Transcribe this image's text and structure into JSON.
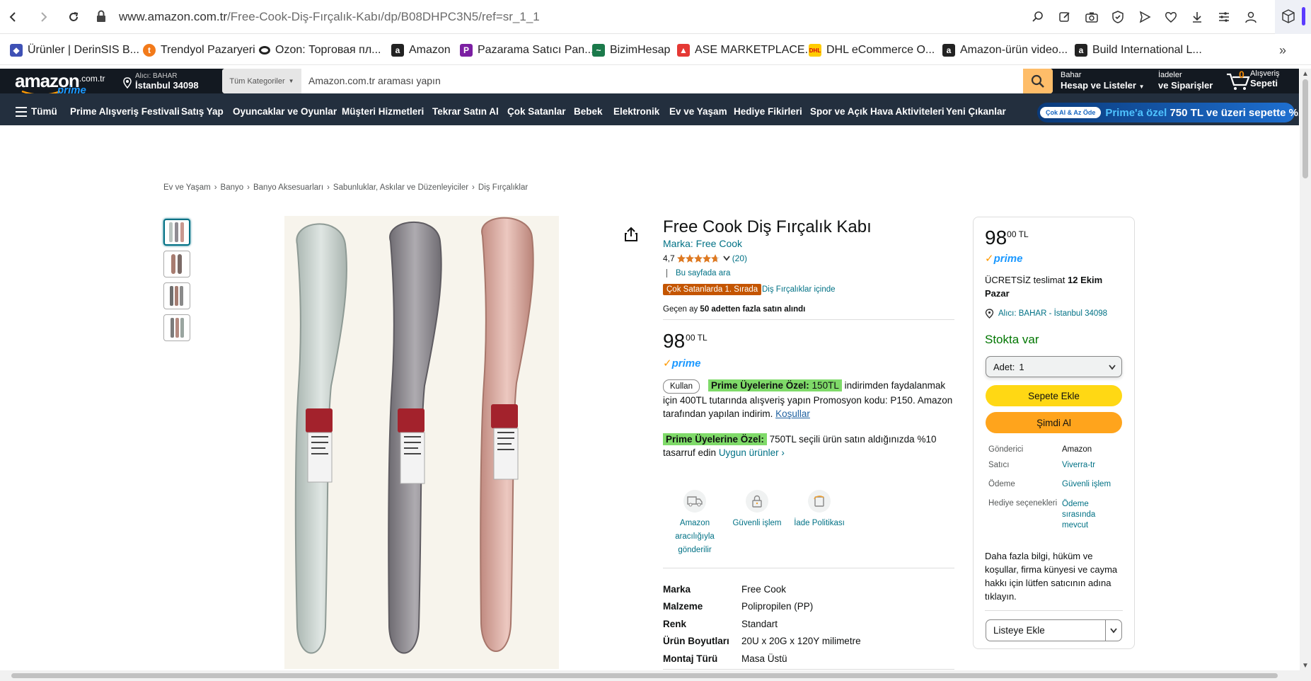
{
  "browser": {
    "url_domain": "www.amazon.com.tr",
    "url_path": "/Free-Cook-Diş-Fırçalık-Kabı/dp/B08DHPC3N5/ref=sr_1_1"
  },
  "bookmarks": [
    {
      "label": "Ürünler | DerinSIS B...",
      "color": "#3f51b5"
    },
    {
      "label": "Trendyol Pazaryeri",
      "color": "#f27a1a"
    },
    {
      "label": "Ozon: Торговая пл...",
      "color": "#222222"
    },
    {
      "label": "Amazon",
      "color": "#222222"
    },
    {
      "label": "Pazarama Satıcı Pan...",
      "color": "#7b1fa2"
    },
    {
      "label": "BizimHesap",
      "color": "#1b7a4b"
    },
    {
      "label": "ASE MARKETPLACE...",
      "color": "#e53935"
    },
    {
      "label": "DHL eCommerce O...",
      "color": "#ffcc00"
    },
    {
      "label": "Amazon-ürün video...",
      "color": "#222222"
    },
    {
      "label": "Build International L...",
      "color": "#222222"
    }
  ],
  "header": {
    "logo_text": "amazon",
    "logo_suffix": ".com.tr",
    "logo_prime": "prime",
    "deliver_line1": "Alıcı: BAHAR",
    "deliver_line2": "İstanbul 34098",
    "search_category": "Tüm Kategoriler",
    "search_placeholder": "Amazon.com.tr araması yapın",
    "account_line1": "Bahar",
    "account_line2": "Hesap ve Listeler",
    "returns_line1": "İadeler",
    "returns_line2": "ve Siparişler",
    "cart_count": "0",
    "cart_line1": "Alışveriş",
    "cart_line2": "Sepeti"
  },
  "nav": {
    "all_label": "Tümü",
    "items": [
      "Prime Alışveriş Festivali",
      "Satış Yap",
      "Oyuncaklar ve Oyunlar",
      "Müşteri Hizmetleri",
      "Tekrar Satın Al",
      "Çok Satanlar",
      "Bebek",
      "Elektronik",
      "Ev ve Yaşam",
      "Hediye Fikirleri",
      "Spor ve Açık Hava Aktiviteleri",
      "Yeni Çıkanlar"
    ],
    "promo_pill": "Çok Al & Az Öde",
    "promo_prefix": "Prime'a özel",
    "promo_text": " 750 TL ve üzeri sepette %10"
  },
  "breadcrumb": [
    "Ev ve Yaşam",
    "Banyo",
    "Banyo Aksesuarları",
    "Sabunluklar, Askılar ve Düzenleyiciler",
    "Diş Fırçalıklar"
  ],
  "product": {
    "title": "Free Cook Diş Fırçalık Kabı",
    "brand_link": "Marka: Free Cook",
    "rating": "4,7",
    "stars": 4.7,
    "rating_count": "(20)",
    "search_page": "Bu sayfada ara",
    "bestseller_badge": "Çok Satanlarda 1. Sırada",
    "bestseller_category": "Diş Fırçalıklar içinde",
    "bought_prefix": "Geçen ay ",
    "bought_bold": "50 adetten fazla satın alındı",
    "price_whole": "98",
    "price_fraction": "00",
    "price_currency": "TL",
    "prime_label": "prime",
    "coupon": {
      "button": "Kullan",
      "badge": "Prime Üyelerine Özel:",
      "amount": "150TL",
      "text": " indirimden faydalanmak için 400TL tutarında alışveriş yapın Promosyon kodu: P150. Amazon tarafından yapılan indirim.",
      "terms": "Koşullar"
    },
    "prime_offer": {
      "badge": "Prime Üyelerine Özel:",
      "text": " 750TL seçili ürün satın aldığınızda %10 tasarruf edin",
      "link": "Uygun ürünler ›"
    },
    "features": [
      {
        "label": "Amazon aracılığıyla gönderilir",
        "icon": "truck-icon"
      },
      {
        "label": "Güvenli işlem",
        "icon": "lock-icon"
      },
      {
        "label": "İade Politikası",
        "icon": "return-icon"
      }
    ],
    "specs": [
      {
        "key": "Marka",
        "value": "Free Cook"
      },
      {
        "key": "Malzeme",
        "value": "Polipropilen (PP)"
      },
      {
        "key": "Renk",
        "value": "Standart"
      },
      {
        "key": "Ürün Boyutları",
        "value": "20U x 20G x 120Y milimetre"
      },
      {
        "key": "Montaj Türü",
        "value": "Masa Üstü"
      }
    ],
    "image_colors": [
      "#c9d3cf",
      "#8f8c92",
      "#d4a49b"
    ]
  },
  "buybox": {
    "price_whole": "98",
    "price_fraction": "00",
    "price_currency": "TL",
    "prime_label": "prime",
    "delivery_prefix": "ÜCRETSİZ teslimat ",
    "delivery_date": "12 Ekim",
    "delivery_day": "Pazar",
    "location": "Alıcı: BAHAR - İstanbul 34098",
    "stock": "Stokta var",
    "qty_label": "Adet:",
    "qty_value": "1",
    "add_to_cart": "Sepete Ekle",
    "buy_now": "Şimdi Al",
    "info": [
      {
        "key": "Gönderici",
        "value": "Amazon"
      },
      {
        "key": "Satıcı",
        "value": "Viverra-tr"
      },
      {
        "key": "Ödeme",
        "value": "Güvenli işlem"
      },
      {
        "key": "Hediye seçenekleri",
        "value": "Ödeme sırasında mevcut"
      }
    ],
    "seller_info": "Daha fazla bilgi, hüküm ve koşullar, firma künyesi ve cayma hakkı için lütfen satıcının adına tıklayın.",
    "add_to_list": "Listeye Ekle"
  },
  "colors": {
    "amazon_dark": "#131921",
    "amazon_nav": "#232f3e",
    "link": "#007185",
    "bestseller": "#c45500",
    "prime_green": "#7fda69",
    "stock_green": "#007600",
    "add_to_cart": "#ffd814",
    "buy_now": "#ffa41c"
  }
}
